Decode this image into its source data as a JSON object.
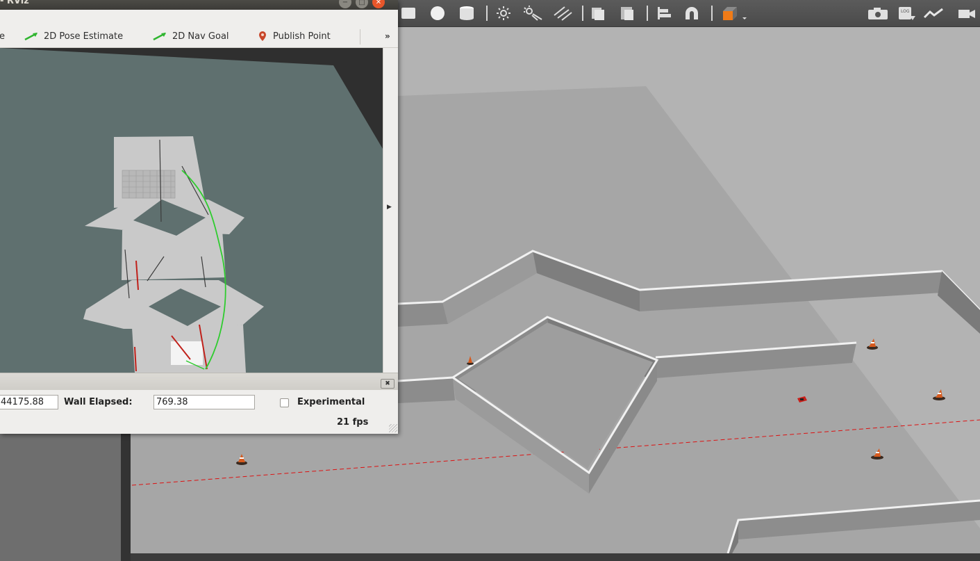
{
  "gazebo": {
    "toolbar_icons": [
      "box-icon",
      "sphere-icon",
      "cylinder-icon",
      "point-light-icon",
      "spot-light-icon",
      "directional-light-icon",
      "copy-icon",
      "paste-icon",
      "align-icon",
      "magnet-icon",
      "view-angle-icon",
      "screenshot-icon",
      "log-icon",
      "plot-icon",
      "video-record-icon"
    ],
    "accent_orange": "#f07b17"
  },
  "rviz": {
    "window_title": "- RViz",
    "toolbar": {
      "items": [
        {
          "label": "e",
          "icon": ""
        },
        {
          "label": "2D Pose Estimate",
          "icon": "pose-arrow-icon"
        },
        {
          "label": "2D Nav Goal",
          "icon": "nav-goal-arrow-icon"
        },
        {
          "label": "Publish Point",
          "icon": "map-pin-icon"
        }
      ],
      "more": "»"
    },
    "time_panel": {
      "ros_time_value": "44175.88",
      "wall_elapsed_label": "Wall Elapsed:",
      "wall_elapsed_value": "769.38",
      "experimental_label": "Experimental",
      "experimental_checked": false
    },
    "fps": "21 fps",
    "path_color": "#2ecc2e",
    "map_bg_color": "#5f706f"
  }
}
